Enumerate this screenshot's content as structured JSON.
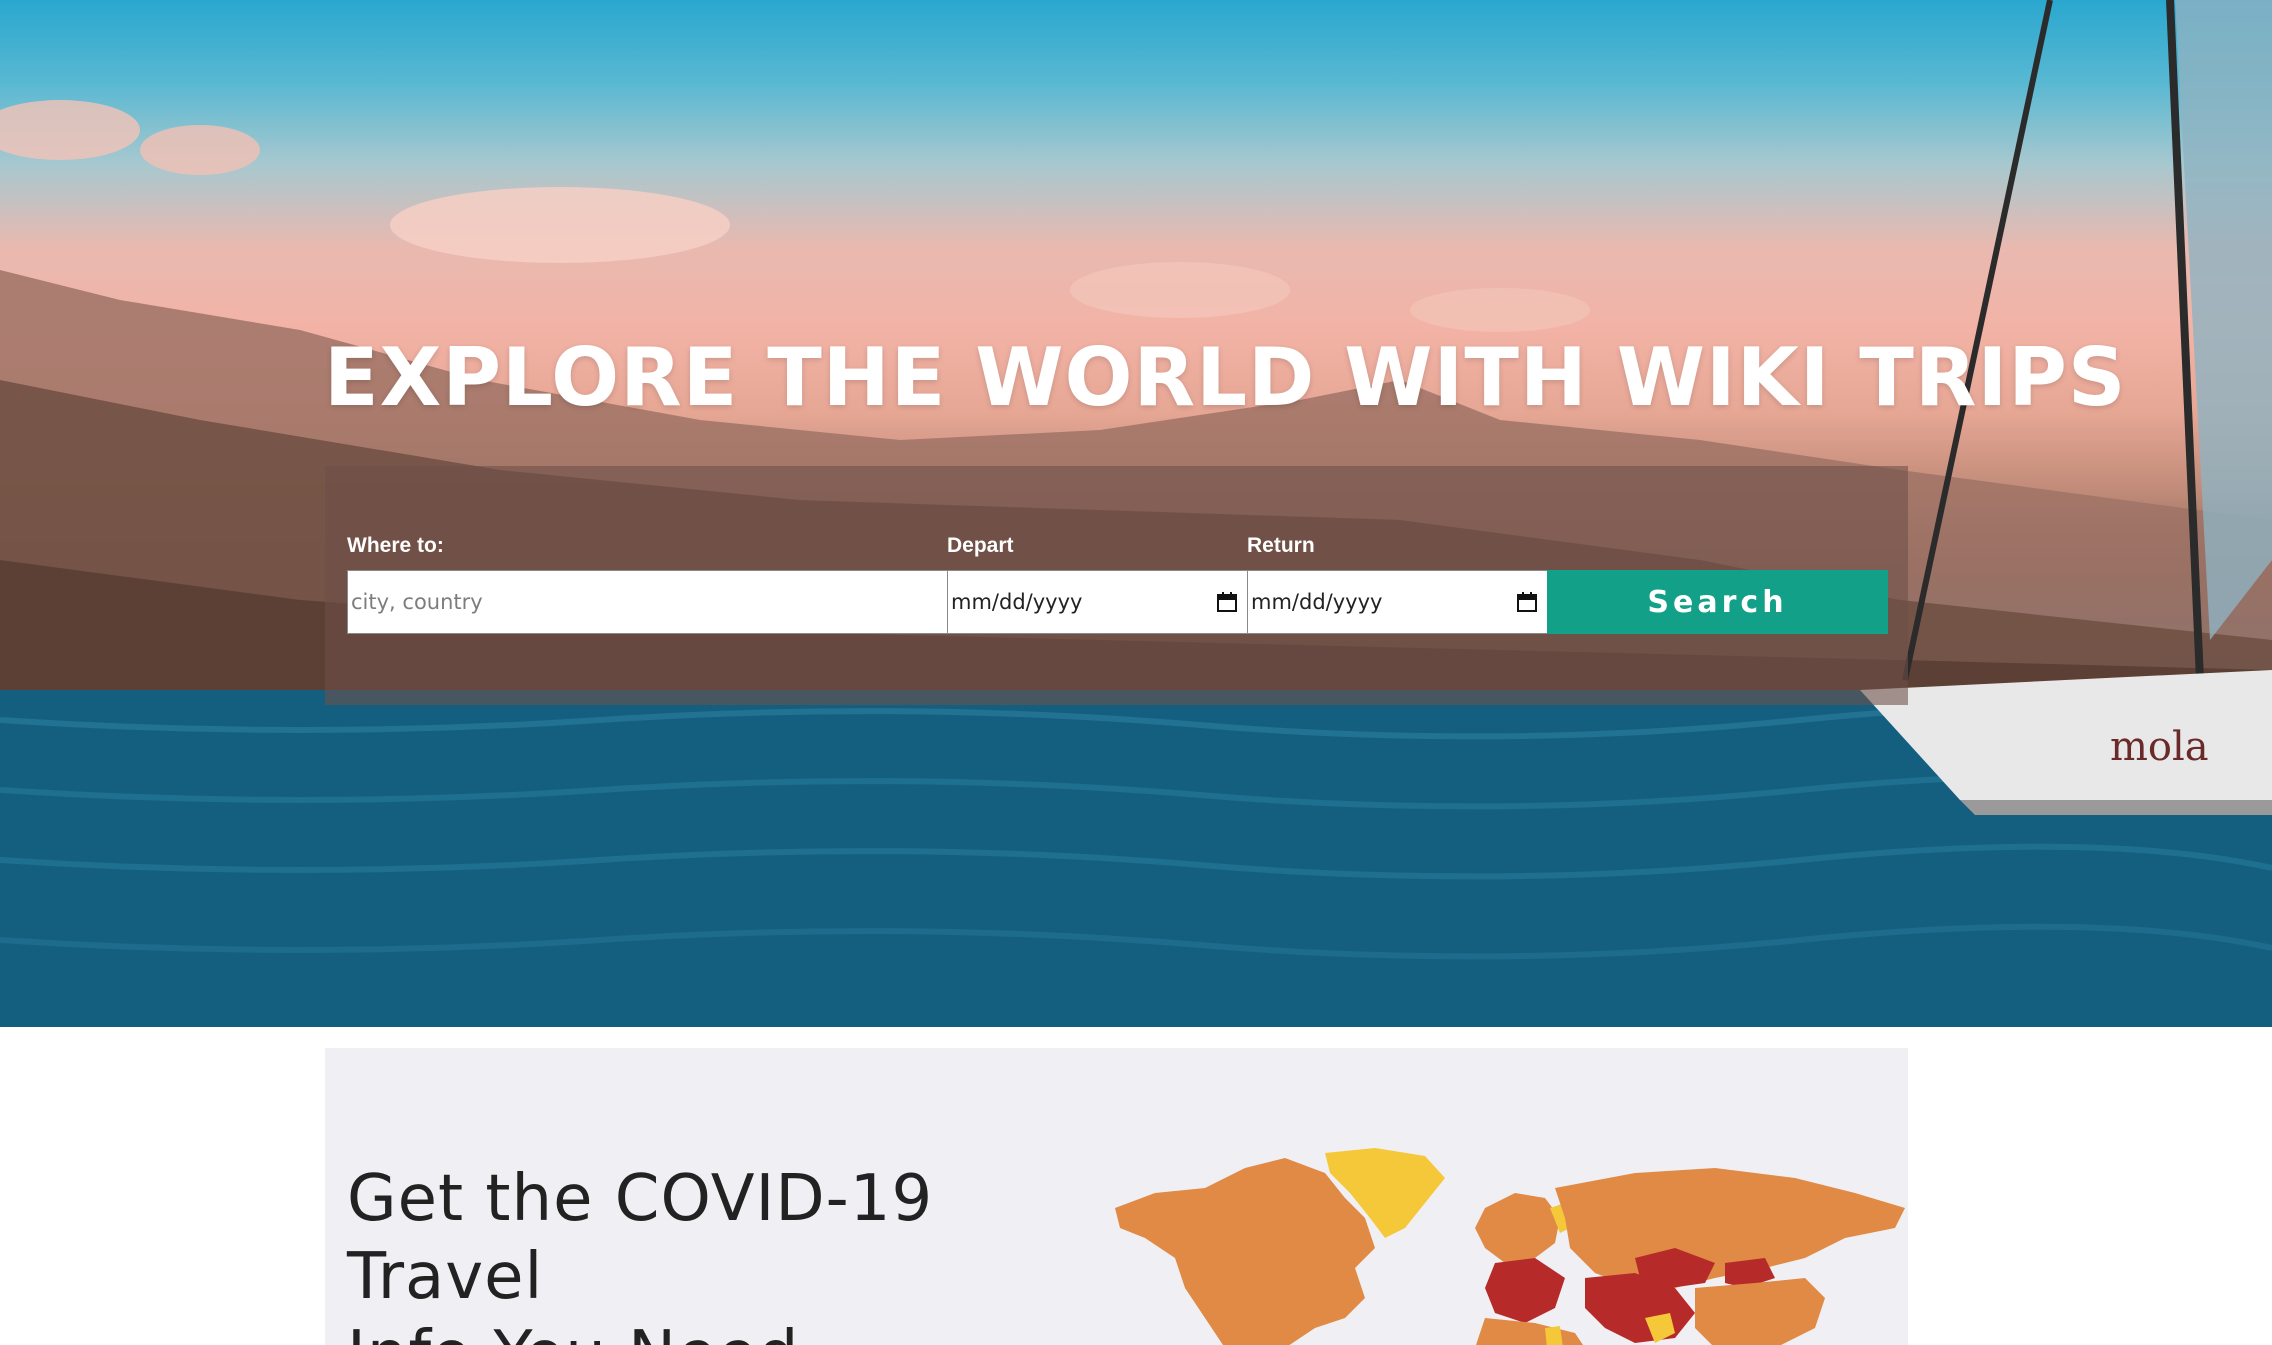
{
  "hero": {
    "title": "EXPLORE THE WORLD WITH WIKI TRIPS"
  },
  "search": {
    "where_label": "Where to:",
    "where_placeholder": "city, country",
    "depart_label": "Depart",
    "depart_value": "mm/dd/yyyy",
    "return_label": "Return",
    "return_value": "mm/dd/yyyy",
    "button_label": "Search",
    "button_color": "#12a089"
  },
  "covid": {
    "title_line1": "Get the COVID-19 Travel",
    "title_line2": "Info You Need"
  },
  "icons": {
    "calendar": "calendar-icon"
  },
  "colors": {
    "map_orange": "#e08a45",
    "map_red": "#b62a2a",
    "map_yellow": "#f5c83a",
    "section_bg": "#f0f0f4"
  }
}
